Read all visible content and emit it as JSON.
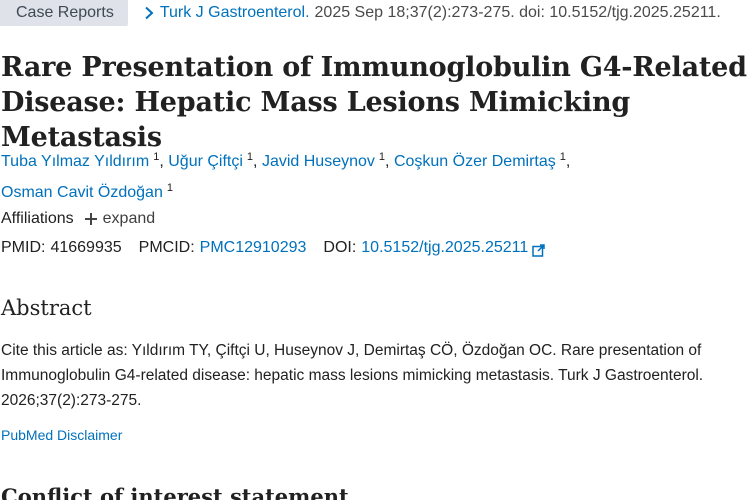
{
  "header": {
    "article_type": "Case Reports",
    "journal": "Turk J Gastroenterol.",
    "citation": "2025 Sep 18;37(2):273-275. doi: 10.5152/tjg.2025.25211."
  },
  "article": {
    "title": "Rare Presentation of Immunoglobulin G4-Related Disease: Hepatic Mass Lesions Mimicking Metastasis",
    "authors": [
      {
        "name": "Tuba Yılmaz Yıldırım",
        "aff": "1"
      },
      {
        "name": "Uğur Çiftçi",
        "aff": "1"
      },
      {
        "name": "Javid Huseynov",
        "aff": "1"
      },
      {
        "name": "Coşkun Özer Demirtaş",
        "aff": "1"
      },
      {
        "name": "Osman Cavit Özdoğan",
        "aff": "1"
      }
    ],
    "separator": ",",
    "affiliations_label": "Affiliations",
    "expand_label": "expand"
  },
  "ids": {
    "pmid_label": "PMID:",
    "pmid": "41669935",
    "pmcid_label": "PMCID:",
    "pmcid": "PMC12910293",
    "doi_label": "DOI:",
    "doi": "10.5152/tjg.2025.25211"
  },
  "abstract": {
    "heading": "Abstract",
    "text": "Cite this article as: Yıldırım TY, Çiftçi U, Huseynov J, Demirtaş CÖ, Özdoğan OC. Rare presentation of Immunoglobulin G4-related disease: hepatic mass lesions mimicking metastasis. Turk J Gastroenterol. 2026;37(2):273-275.",
    "disclaimer": "PubMed Disclaimer"
  },
  "conflict": {
    "heading": "Conflict of interest statement"
  },
  "icons": {
    "chevron": "chevron-right-icon",
    "plus": "plus-icon",
    "external": "external-link-icon"
  },
  "colors": {
    "link": "#0071bc",
    "badge_bg": "#dfe2e8",
    "text": "#212121"
  }
}
